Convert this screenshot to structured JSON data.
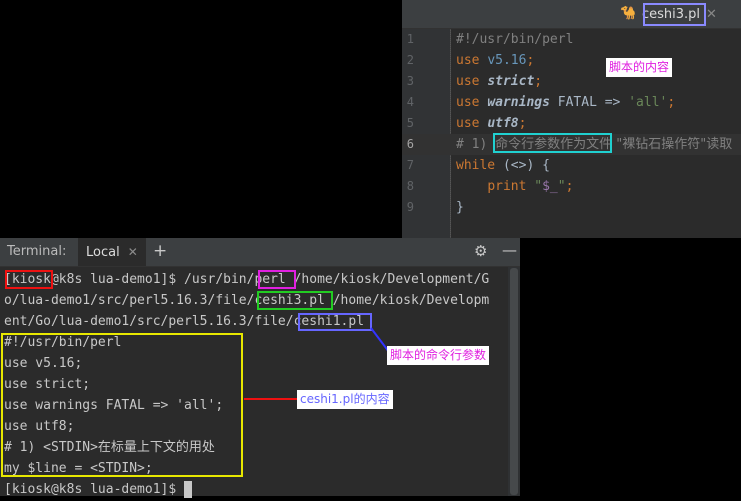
{
  "editor": {
    "tab": {
      "filename": "ceshi3.pl",
      "close": "✕"
    },
    "lines": [
      {
        "n": "1",
        "parts": [
          [
            "cmt",
            "#!/usr/bin/perl"
          ]
        ]
      },
      {
        "n": "2",
        "parts": [
          [
            "kw",
            "use "
          ],
          [
            "num",
            "v5.16"
          ],
          [
            "kw",
            ";"
          ]
        ]
      },
      {
        "n": "3",
        "parts": [
          [
            "kw",
            "use "
          ],
          [
            "bi",
            "strict"
          ],
          [
            "kw",
            ";"
          ]
        ]
      },
      {
        "n": "4",
        "parts": [
          [
            "kw",
            "use "
          ],
          [
            "bi",
            "warnings"
          ],
          [
            "plain",
            " FATAL => "
          ],
          [
            "str",
            "'all'"
          ],
          [
            "kw",
            ";"
          ]
        ]
      },
      {
        "n": "5",
        "parts": [
          [
            "kw",
            "use "
          ],
          [
            "bi",
            "utf8"
          ],
          [
            "kw",
            ";"
          ]
        ]
      },
      {
        "n": "6",
        "parts": [
          [
            "cmt",
            "# 1) "
          ],
          [
            "cmtcn",
            "命令行参数作为文件"
          ],
          [
            "cmtcn",
            " \"裸钻石操作符\"读取"
          ]
        ]
      },
      {
        "n": "7",
        "parts": [
          [
            "kw",
            "while "
          ],
          [
            "plain",
            "(<>) {"
          ]
        ]
      },
      {
        "n": "8",
        "parts": [
          [
            "plain",
            "    "
          ],
          [
            "kw",
            "print "
          ],
          [
            "str",
            "\""
          ],
          [
            "var",
            "$_"
          ],
          [
            "str",
            "\""
          ],
          [
            "kw",
            ";"
          ]
        ]
      },
      {
        "n": "9",
        "parts": [
          [
            "plain",
            "}"
          ]
        ]
      }
    ]
  },
  "terminal": {
    "title": "Terminal:",
    "tab_label": "Local",
    "tab_close": "✕",
    "add": "+",
    "settings_icon": "⚙",
    "minimize_icon": "—",
    "lines": [
      "[kiosk@k8s lua-demo1]$ /usr/bin/perl /home/kiosk/Development/G",
      "o/lua-demo1/src/perl5.16.3/file/ceshi3.pl /home/kiosk/Developm",
      "ent/Go/lua-demo1/src/perl5.16.3/file/ceshi1.pl",
      "#!/usr/bin/perl",
      "use v5.16;",
      "use strict;",
      "use warnings FATAL => 'all';",
      "use utf8;",
      "# 1) <STDIN>在标量上下文的用处",
      "my $line = <STDIN>;",
      "[kiosk@k8s lua-demo1]$ "
    ]
  },
  "annotations": {
    "script_content": "脚本的内容",
    "script_args": "脚本的命令行参数",
    "ceshi1_content": "ceshi1.pl的内容"
  },
  "colors": {
    "red": "#ee1111",
    "magenta": "#e020e0",
    "green": "#22cc22",
    "blue": "#6666ff",
    "yellow": "#e8e800",
    "cyan": "#20d0d0"
  }
}
